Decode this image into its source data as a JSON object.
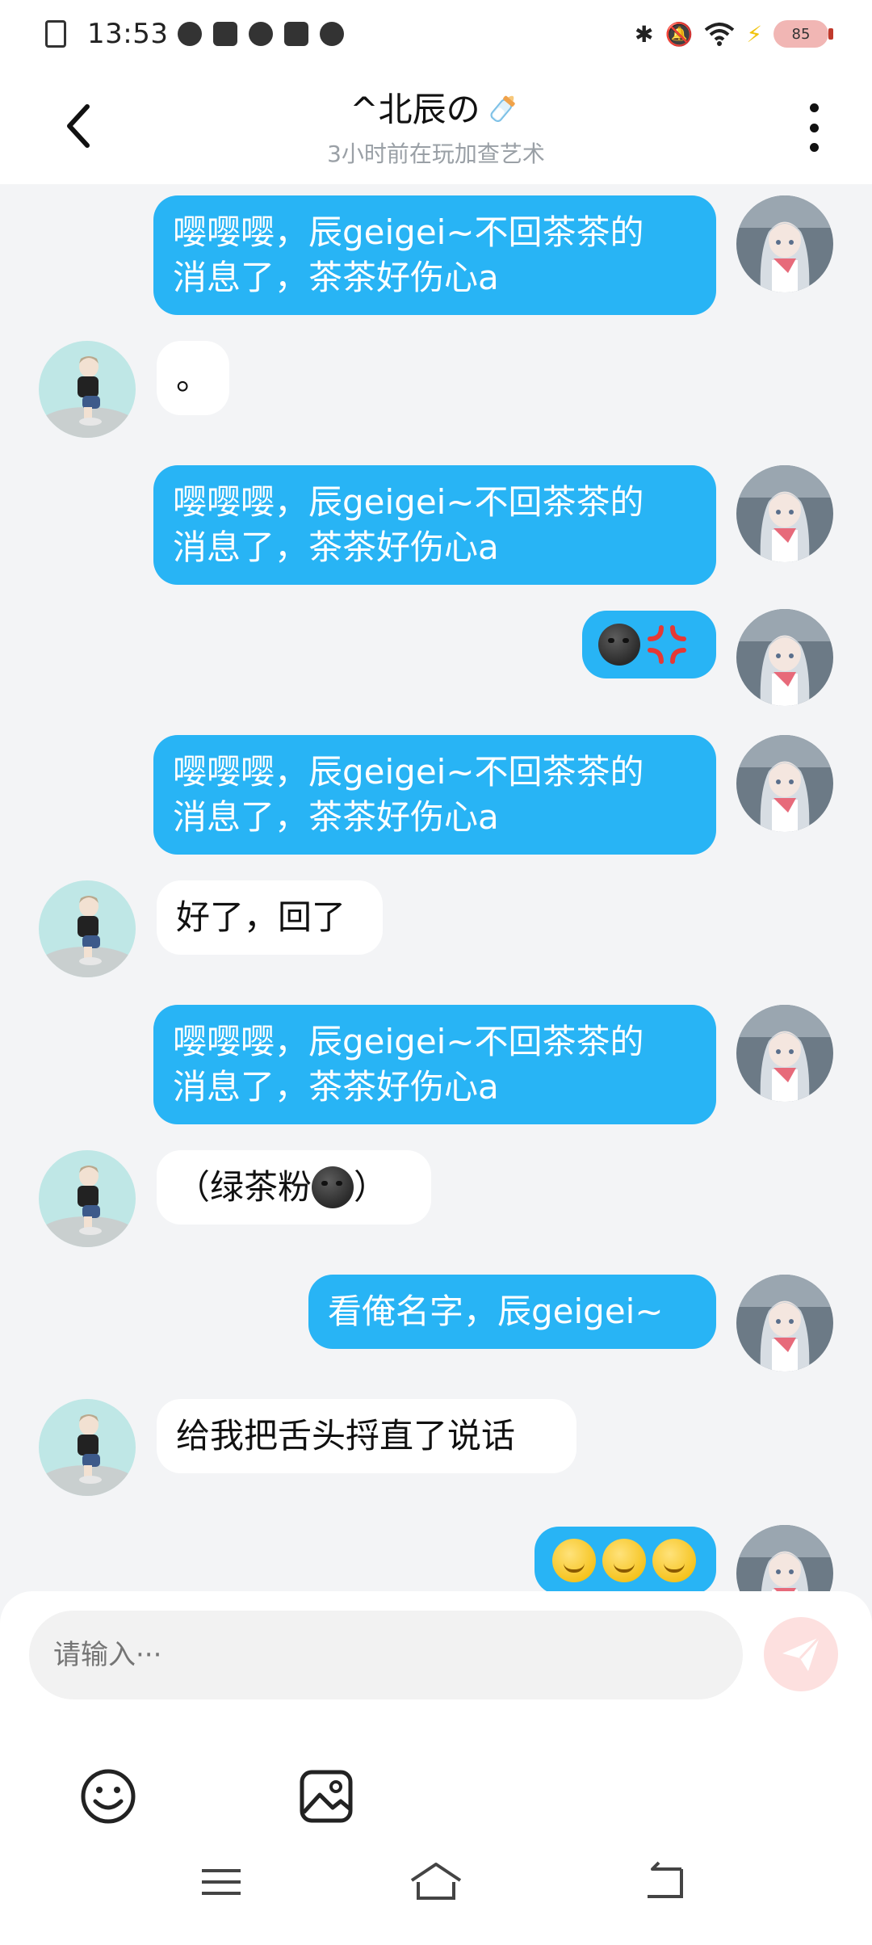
{
  "status_bar": {
    "time": "13:53",
    "battery": "85",
    "icons": [
      "document-x-icon",
      "compass-icon",
      "mail-icon",
      "play-icon",
      "bus-icon",
      "cloud-icon",
      "bluetooth-icon",
      "bell-off-icon",
      "wifi-icon",
      "charging-bolt-icon",
      "battery-icon"
    ]
  },
  "header": {
    "title": "^北辰の",
    "title_emoji": "baby-bottle-icon",
    "subtitle": "3小时前在玩加查艺术"
  },
  "messages": [
    {
      "side": "out",
      "text_line1": "嘤嘤嘤，辰geigei~不回茶茶的",
      "text_line2": "消息了，茶茶好伤心a"
    },
    {
      "side": "in",
      "text": "。"
    },
    {
      "side": "out",
      "text_line1": "嘤嘤嘤，辰geigei~不回茶茶的",
      "text_line2": "消息了，茶茶好伤心a"
    },
    {
      "side": "out",
      "emoji": [
        "dark-face-icon",
        "anger-symbol-icon"
      ]
    },
    {
      "side": "out",
      "text_line1": "嘤嘤嘤，辰geigei~不回茶茶的",
      "text_line2": "消息了，茶茶好伤心a"
    },
    {
      "side": "in",
      "text": "好了，回了"
    },
    {
      "side": "out",
      "text_line1": "嘤嘤嘤，辰geigei~不回茶茶的",
      "text_line2": "消息了，茶茶好伤心a"
    },
    {
      "side": "in",
      "text_before": "（绿茶粉",
      "text_after": "）"
    },
    {
      "side": "out",
      "text": "看俺名字，辰geigei~"
    },
    {
      "side": "in",
      "text": "给我把舌头捋直了说话"
    },
    {
      "side": "out",
      "emoji": [
        "smirk-face-icon",
        "smirk-face-icon",
        "smirk-face-icon"
      ]
    }
  ],
  "input": {
    "placeholder": "请输入···"
  },
  "colors": {
    "outgoing_bubble": "#28b4f5",
    "incoming_bubble": "#ffffff",
    "chat_bg": "#f3f4f6",
    "send_button": "#fde0df"
  }
}
